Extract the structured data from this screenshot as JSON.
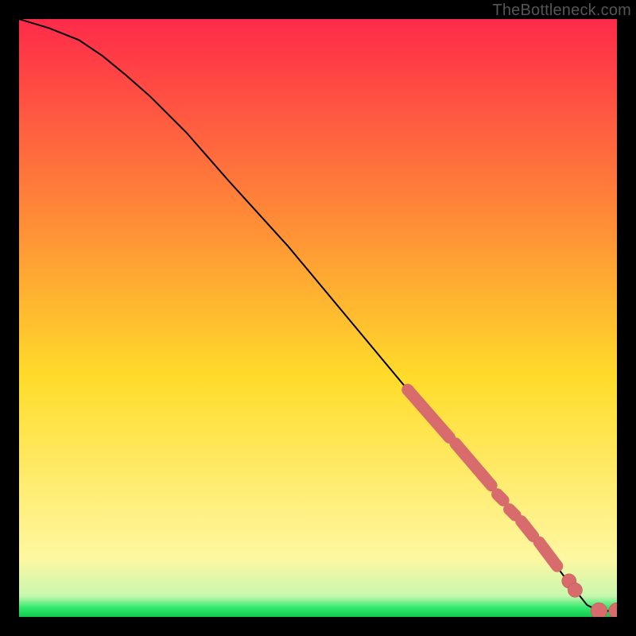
{
  "attribution": "TheBottleneck.com",
  "colors": {
    "background": "#000000",
    "gradient_top": "#ff2a4a",
    "gradient_mid_upper": "#ff7b3a",
    "gradient_mid": "#ffdc2a",
    "gradient_lower": "#fff7a0",
    "gradient_green": "#2fe86b",
    "curve": "#000000",
    "dot_fill": "#d86b6b",
    "dot_stroke": "#b84f4f"
  },
  "chart_data": {
    "type": "line",
    "title": "",
    "xlabel": "",
    "ylabel": "",
    "xlim": [
      0,
      100
    ],
    "ylim": [
      0,
      100
    ],
    "grid": false,
    "legend": false,
    "curve": [
      {
        "x": 0,
        "y": 100
      },
      {
        "x": 5,
        "y": 98.5
      },
      {
        "x": 10,
        "y": 96.5
      },
      {
        "x": 14,
        "y": 93.8
      },
      {
        "x": 18,
        "y": 90.5
      },
      {
        "x": 22,
        "y": 87
      },
      {
        "x": 28,
        "y": 81
      },
      {
        "x": 35,
        "y": 73
      },
      {
        "x": 45,
        "y": 62
      },
      {
        "x": 55,
        "y": 50
      },
      {
        "x": 65,
        "y": 38
      },
      {
        "x": 72,
        "y": 30
      },
      {
        "x": 78,
        "y": 23
      },
      {
        "x": 83,
        "y": 17
      },
      {
        "x": 88,
        "y": 11
      },
      {
        "x": 91,
        "y": 7
      },
      {
        "x": 93,
        "y": 4.5
      },
      {
        "x": 95,
        "y": 2
      },
      {
        "x": 97,
        "y": 1
      },
      {
        "x": 100,
        "y": 1
      }
    ],
    "dot_segments": [
      {
        "x0": 65,
        "y0": 38,
        "x1": 72,
        "y1": 30
      },
      {
        "x0": 73,
        "y0": 29,
        "x1": 79,
        "y1": 22
      },
      {
        "x0": 80,
        "y0": 20.5,
        "x1": 81,
        "y1": 19.5
      },
      {
        "x0": 82,
        "y0": 18,
        "x1": 83,
        "y1": 17
      },
      {
        "x0": 84,
        "y0": 16,
        "x1": 86,
        "y1": 13.5
      },
      {
        "x0": 87,
        "y0": 12.5,
        "x1": 90,
        "y1": 8.5
      }
    ],
    "dots": [
      {
        "x": 92,
        "y": 6,
        "r": 0.9
      },
      {
        "x": 93,
        "y": 4.5,
        "r": 0.9
      },
      {
        "x": 97,
        "y": 1,
        "r": 1.1
      },
      {
        "x": 100,
        "y": 1,
        "r": 1.1
      }
    ]
  }
}
